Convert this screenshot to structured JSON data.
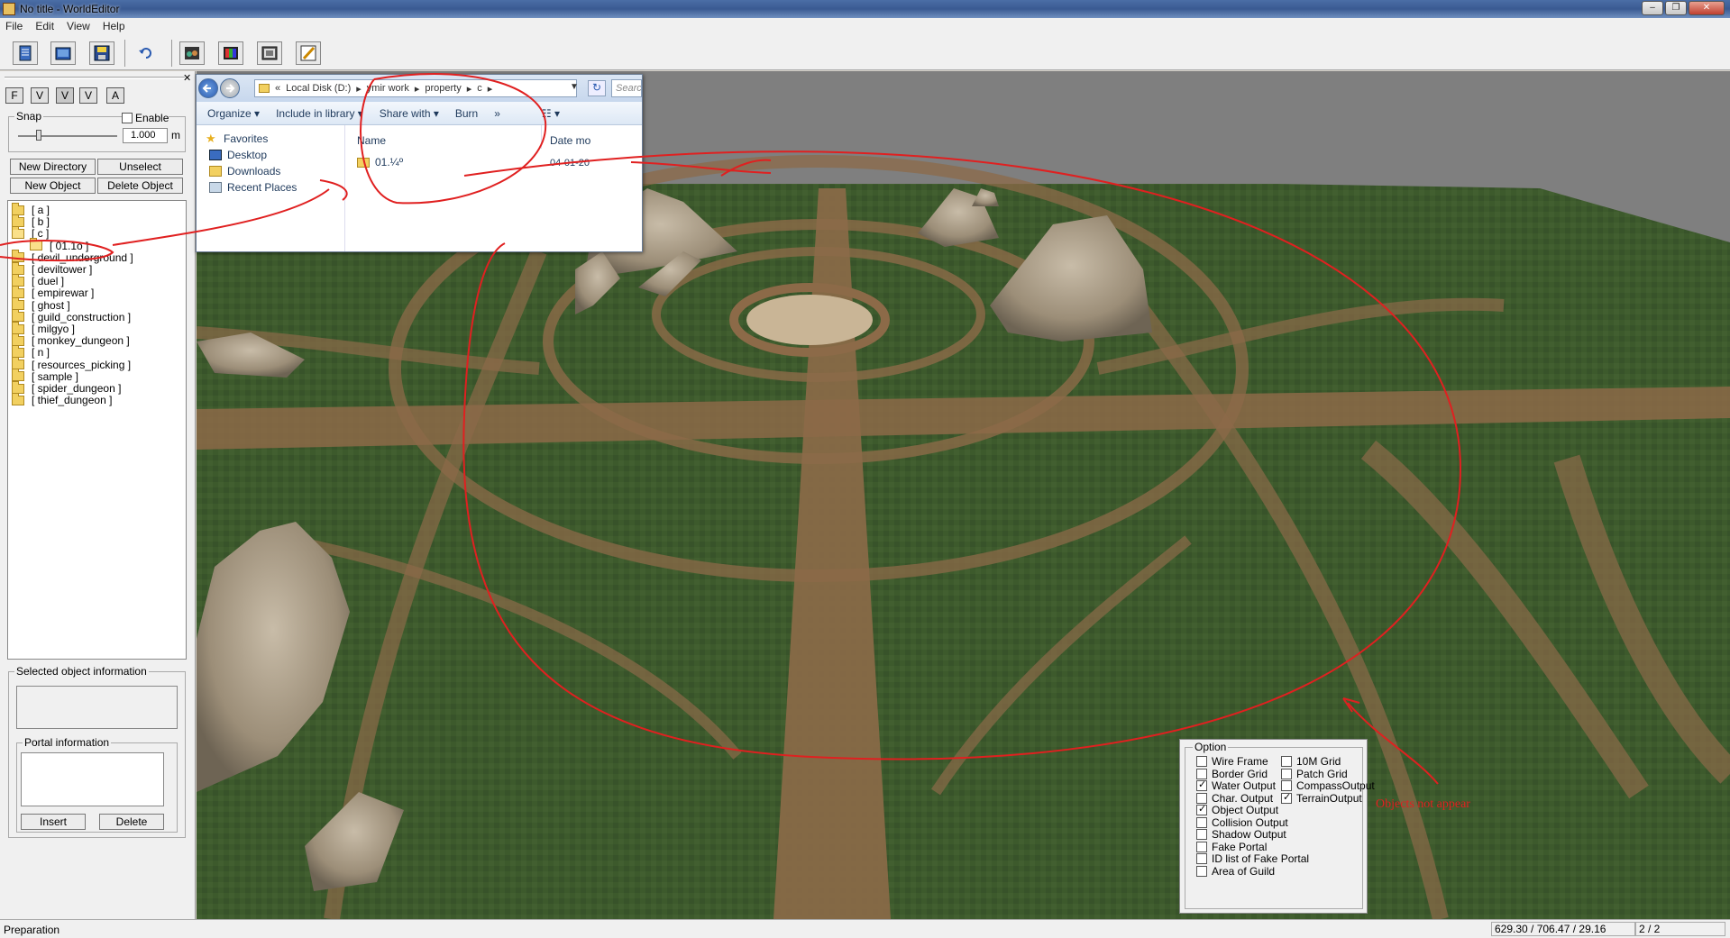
{
  "window": {
    "title": "No title - WorldEditor",
    "controls": [
      "–",
      "❐",
      "✕"
    ]
  },
  "menu": [
    "File",
    "Edit",
    "View",
    "Help"
  ],
  "toolbar": {
    "icons": [
      "new-file-icon",
      "open-icon",
      "save-icon",
      "undo-icon",
      "terrain-view-icon",
      "color-view-icon",
      "map-view-icon",
      "brush-icon"
    ]
  },
  "left": {
    "mode_buttons": [
      "F",
      "V",
      "V",
      "V",
      "A"
    ],
    "snap": {
      "label": "Snap",
      "enable_label": "Enable",
      "value": "1.000",
      "unit": "m"
    },
    "buttons": {
      "new_directory": "New Directory",
      "unselect": "Unselect",
      "new_object": "New Object",
      "delete_object": "Delete Object"
    },
    "tree": [
      {
        "label": "[ a ]",
        "level": 0
      },
      {
        "label": "[ b ]",
        "level": 0
      },
      {
        "label": "[ c ]",
        "level": 0,
        "open": true
      },
      {
        "label": "[ 01.1o ]",
        "level": 1,
        "open": true
      },
      {
        "label": "[ devil_underground ]",
        "level": 0
      },
      {
        "label": "[ deviltower ]",
        "level": 0
      },
      {
        "label": "[ duel ]",
        "level": 0
      },
      {
        "label": "[ empirewar ]",
        "level": 0
      },
      {
        "label": "[ ghost ]",
        "level": 0
      },
      {
        "label": "[ guild_construction ]",
        "level": 0
      },
      {
        "label": "[ milgyo ]",
        "level": 0
      },
      {
        "label": "[ monkey_dungeon ]",
        "level": 0
      },
      {
        "label": "[ n ]",
        "level": 0
      },
      {
        "label": "[ resources_picking ]",
        "level": 0
      },
      {
        "label": "[ sample ]",
        "level": 0
      },
      {
        "label": "[ spider_dungeon ]",
        "level": 0
      },
      {
        "label": "[ thief_dungeon ]",
        "level": 0
      }
    ],
    "selected_info_label": "Selected object information",
    "portal_info_label": "Portal information",
    "insert_label": "Insert",
    "delete_label": "Delete"
  },
  "explorer": {
    "breadcrumbs": [
      "«",
      "Local Disk (D:)",
      "▸",
      "ymir work",
      "▸",
      "property",
      "▸",
      "c",
      "▸"
    ],
    "search_placeholder": "Search",
    "commands": [
      "Organize ▾",
      "Include in library ▾",
      "Share with ▾",
      "Burn",
      "»"
    ],
    "nav": [
      "Favorites",
      "Desktop",
      "Downloads",
      "Recent Places"
    ],
    "columns": [
      "Name",
      "Date mo"
    ],
    "files": [
      {
        "name": "01.¼º",
        "date": "04-01-20"
      }
    ]
  },
  "options": {
    "title": "Option",
    "left_items": [
      {
        "label": "Wire Frame",
        "checked": false
      },
      {
        "label": "Border Grid",
        "checked": false
      },
      {
        "label": "Water Output",
        "checked": true
      },
      {
        "label": "Char. Output",
        "checked": false
      },
      {
        "label": "Object Output",
        "checked": true
      },
      {
        "label": "Collision Output",
        "checked": false
      },
      {
        "label": "Shadow Output",
        "checked": false
      },
      {
        "label": "Fake Portal",
        "checked": false
      },
      {
        "label": "ID list of Fake Portal",
        "checked": false
      },
      {
        "label": "Area of Guild",
        "checked": false
      }
    ],
    "right_items": [
      {
        "label": "10M Grid",
        "checked": false
      },
      {
        "label": "Patch Grid",
        "checked": false
      },
      {
        "label": "CompassOutput",
        "checked": false
      },
      {
        "label": "TerrainOutput",
        "checked": true
      }
    ]
  },
  "annotation_text": "Objects not appear",
  "status": {
    "left": "Preparation",
    "coords": "629.30 / 706.47 / 29.16",
    "page": "2 / 2"
  },
  "colors": {
    "annotation": "#e02020",
    "grass": "#3d5a2c",
    "path": "#8c6a48",
    "rock": "#a89c8a"
  }
}
